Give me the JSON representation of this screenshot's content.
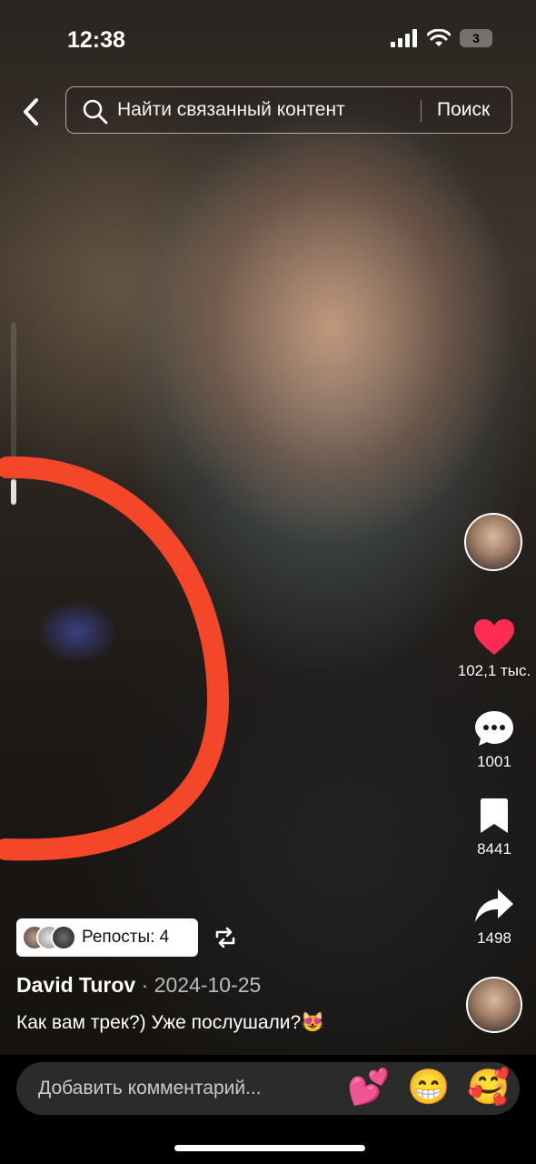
{
  "status_bar": {
    "time": "12:38",
    "battery": "3"
  },
  "search": {
    "placeholder": "Найти связанный контент",
    "button_label": "Поиск"
  },
  "rail": {
    "likes": "102,1 тыс.",
    "comments": "1001",
    "favorites": "8441",
    "shares": "1498"
  },
  "reposts": {
    "label": "Репосты: 4"
  },
  "post": {
    "author": "David Turov",
    "date": "· 2024-10-25",
    "caption": "Как вам трек?) Уже послушали?😻"
  },
  "comment": {
    "placeholder": "Добавить комментарий..."
  },
  "quick_emojis": [
    "💕",
    "😁",
    "🥰"
  ],
  "colors": {
    "like": "#fe2c55",
    "annotation": "#f4472a"
  }
}
